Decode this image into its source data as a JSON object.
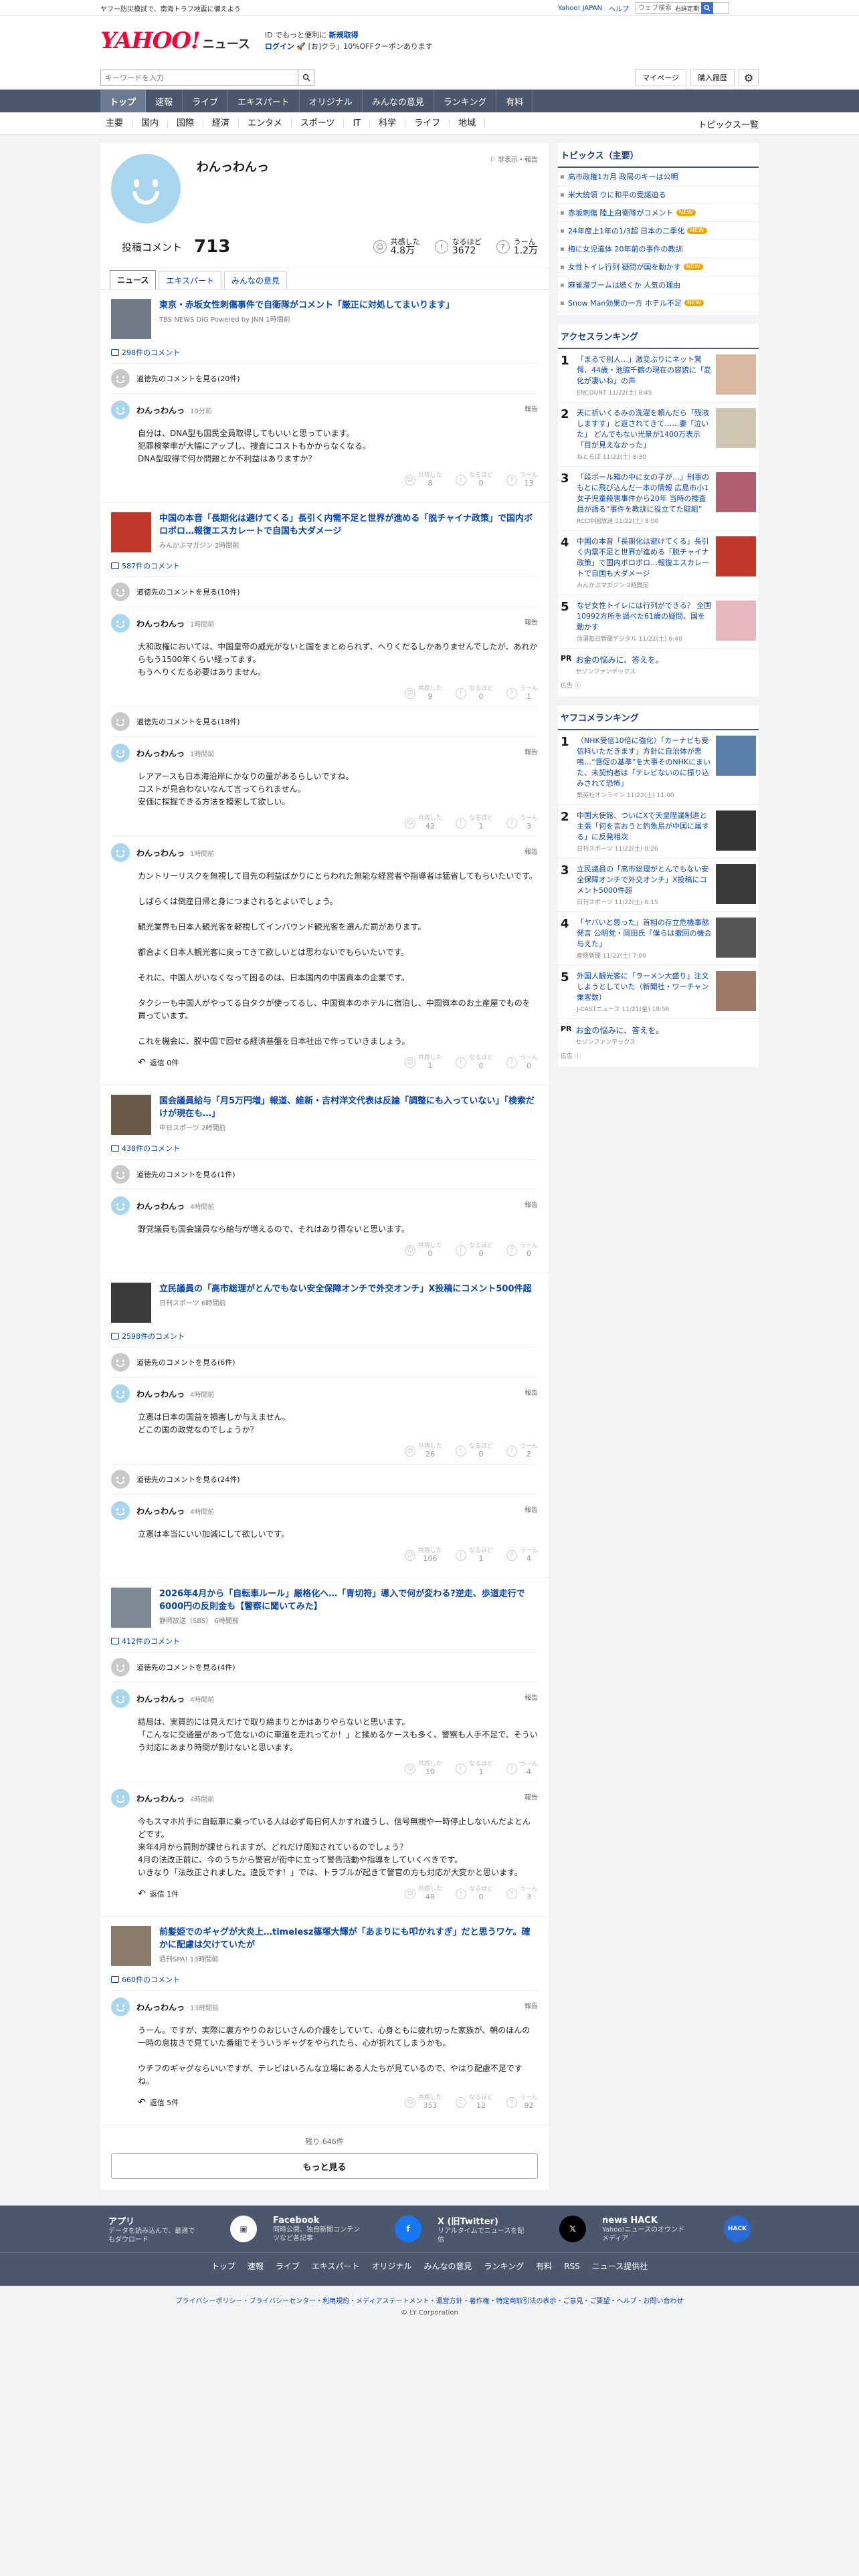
{
  "topstrip": {
    "promo": "ヤフー防災模試で、南海トラフ地震に備えよう",
    "yahoo_japan": "Yahoo! JAPAN",
    "help": "ヘルプ",
    "search_placeholder": "ウェブ検索",
    "check_label": "右詳定期"
  },
  "header": {
    "logo_text": "YAHOO!",
    "logo_sub": "ニュース",
    "promo_line1a": "ID でもっと便利に ",
    "promo_line1b": "新規取得",
    "login": "ログイン",
    "promo_line2": "[お]クラ」10%OFFクーポンあります"
  },
  "subhead": {
    "keyword_placeholder": "キーワードを入力",
    "mypage": "マイページ",
    "purchase": "購入履歴"
  },
  "gnav": [
    "トップ",
    "速報",
    "ライブ",
    "エキスパート",
    "オリジナル",
    "みんなの意見",
    "ランキング",
    "有料"
  ],
  "catnav": [
    "主要",
    "国内",
    "国際",
    "経済",
    "エンタメ",
    "スポーツ",
    "IT",
    "科学",
    "ライフ",
    "地域"
  ],
  "catnav_last": "トピックス一覧",
  "profile": {
    "name": "わんっわんっ",
    "report": "非表示・報告",
    "comments_label": "投稿コメント",
    "comments_count": "713",
    "stats": [
      {
        "icon": "☺",
        "label": "共感した",
        "value": "4.8万"
      },
      {
        "icon": "!",
        "label": "なるほど",
        "value": "3672"
      },
      {
        "icon": "?",
        "label": "うーん",
        "value": "1.2万"
      }
    ]
  },
  "tabs": [
    "ニュース",
    "エキスパート",
    "みんなの意見"
  ],
  "articles": [
    {
      "title": "東京・赤坂女性刺傷事件で自衛隊がコメント「厳正に対処してまいります」",
      "source": "TBS NEWS DIG Powered by JNN 1時間前",
      "count": "298件のコメント",
      "other": "道徳先のコメントを見る(20件)",
      "comments": [
        {
          "name": "わんっわんっ",
          "time": "10分前",
          "body": "自分は、DNA型も国民全員取得してもいいと思っています。\n犯罪検挙率が大幅にアップし、捜査にコストもかからなくなる。\nDNA型取得で何か問題とか不利益はありますか？",
          "r": [
            "8",
            "0",
            "13"
          ],
          "reply": ""
        }
      ]
    },
    {
      "title": "中国の本音「長期化は避けてくる」長引く内需不足と世界が進める「脱チャイナ政策」で国内ボロボロ…報復エスカレートで自国も大ダメージ",
      "source": "みんかぶマガジン 2時間前",
      "count": "587件のコメント",
      "other": "道徳先のコメントを見る(10件)",
      "comments": [
        {
          "name": "わんっわんっ",
          "time": "1時間前",
          "body": "大和政権においては、中国皇帝の威光がないと国をまとめられず、へりくだるしかありませんでしたが、あれからもう1500年くらい経ってます。\nもうへりくだる必要はありません。",
          "r": [
            "9",
            "0",
            "1"
          ],
          "reply": ""
        }
      ],
      "other2": "道徳先のコメントを見る(18件)",
      "comments2": [
        {
          "name": "わんっわんっ",
          "time": "1時間前",
          "body": "レアアースも日本海沿岸にかなりの量があるらしいですね。\nコストが見合わないなんて言ってられません。\n安価に採掘できる方法を模索して欲しい。",
          "r": [
            "42",
            "1",
            "3"
          ],
          "reply": ""
        },
        {
          "name": "わんっわんっ",
          "time": "1時間前",
          "body": "カントリーリスクを無視して目先の利益ばかりにとらわれた無能な経営者や指導者は猛省してもらいたいです。\n\nしばらくは倒産日帰と身につまされるとよいでしょう。\n\n観光業界も日本人観光客を軽視してインバウンド観光客を選んだ罰があります。\n\n都合よく日本人観光客に戻ってきて欲しいとは思わないでもらいたいです。\n\nそれに、中国人がいなくなって困るのは、日本国内の中国資本の企業です。\n\nタクシーも中国人がやってる白タクが使ってるし、中国資本のホテルに宿泊し、中国資本のお土産屋でものを買っています。\n\nこれを機会に、脱中国で回せる経済基盤を日本社出で作っていきましょう。",
          "r": [
            "1",
            "0",
            "0"
          ],
          "reply": "返信 0件"
        }
      ]
    },
    {
      "title": "国会議員給与「月5万円増」報道、維新・吉村洋文代表は反論「調整にも入っていない」「検索だけが現在も…」",
      "source": "中日スポーツ 2時間前",
      "count": "438件のコメント",
      "other": "道徳先のコメントを見る(1件)",
      "comments": [
        {
          "name": "わんっわんっ",
          "time": "4時間前",
          "body": "野党議員も国会議員なら給与が増えるので、それはあり得ないと思います。",
          "r": [
            "0",
            "0",
            "0"
          ],
          "reply": ""
        }
      ]
    },
    {
      "title": "立民議員の「高市総理がとんでもない安全保障オンチで外交オンチ」X投稿にコメント500件超",
      "source": "日刊スポーツ 6時間前",
      "count": "2598件のコメント",
      "other": "道徳先のコメントを見る(6件)",
      "comments": [
        {
          "name": "わんっわんっ",
          "time": "4時間前",
          "body": "立憲は日本の国益を損害しか与えません。\nどこの国の政党なのでしょうか？",
          "r": [
            "26",
            "0",
            "2"
          ],
          "reply": ""
        }
      ],
      "other2": "道徳先のコメントを見る(24件)",
      "comments2": [
        {
          "name": "わんっわんっ",
          "time": "4時間前",
          "body": "立憲は本当にいい加減にして欲しいです。",
          "r": [
            "106",
            "1",
            "4"
          ],
          "reply": ""
        }
      ]
    },
    {
      "title": "2026年4月から「自転車ルール」厳格化へ…「青切符」導入で何が変わる?逆走、歩道走行で6000円の反則金も【警察に聞いてみた】",
      "source": "静岡放送（SBS） 6時間前",
      "count": "412件のコメント",
      "other": "道徳先のコメントを見る(4件)",
      "comments": [
        {
          "name": "わんっわんっ",
          "time": "4時間前",
          "body": "結局は、実質的には見えだけで取り締まりとかはありやらないと思います。\n「こんなに交通量があって危ないのに車道を走れってか！」と揉めるケースも多く、警察も人手不足で、そういう対応にあまり時間が割けないと思います。",
          "r": [
            "10",
            "1",
            "4"
          ],
          "reply": ""
        },
        {
          "name": "わんっわんっ",
          "time": "4時間前",
          "body": "今もスマホ片手に自転車に乗っている人は必ず毎日何人かすれ違うし、信号無視や一時停止しないんだよとんどです。\n来年4月から罰則が課せられますが、どれだけ周知されているのでしょう？\n4月の法改正前に、今のうちから警官が街中に立って警告活動や指導をしていくべきです。\nいきなり「法改正されました。違反です！」では、トラブルが起きて警官の方も対応が大変かと思います。",
          "r": [
            "48",
            "0",
            "3"
          ],
          "reply": "返信 1件"
        }
      ]
    },
    {
      "title": "前髪姫でのギャグが大炎上…timelesz篠塚大輝が「あまりにも叩かれすぎ」だと思うワケ。確かに配慮は欠けていたが",
      "source": "週刊SPA! 13時間前",
      "count": "660件のコメント",
      "other": "",
      "comments": [
        {
          "name": "わんっわんっ",
          "time": "13時間前",
          "body": "うーん。ですが、実際に裏方やりのおじいさんの介護をしていて、心身ともに疲れ切った家族が、朝のほんの一時の息抜きで見ていた番組でそういうギャグをやられたら、心が折れてしまうかも。\n\nウチフのギャグならいいですが、テレビはいろんな立場にある人たちが見ているので、やはり配慮不足ですね。",
          "r": [
            "353",
            "12",
            "92"
          ],
          "reply": "返信 5件"
        }
      ]
    }
  ],
  "react_labels": [
    "共感した",
    "なるほど",
    "うーん"
  ],
  "more": {
    "remaining": "残り 646件",
    "button": "もっと見る"
  },
  "report_label": "報告",
  "right": {
    "topics_title": "トピックス（主要）",
    "topics": [
      {
        "t": "高市政権1カ月 政局のキーは公明",
        "new": false
      },
      {
        "t": "米大統領 ウに和平の受諾迫る",
        "new": false
      },
      {
        "t": "赤坂刺傷 陸上自衛隊がコメント",
        "new": true
      },
      {
        "t": "24年度上1年の1/3超 日本の二季化",
        "new": true
      },
      {
        "t": "梅に女児遺体 20年前の事件の教訓",
        "new": false
      },
      {
        "t": "女性トイレ行列 疑問が国を動かす",
        "new": true
      },
      {
        "t": "麻雀漫ブームは続くか 人気の理由",
        "new": false
      },
      {
        "t": "Snow Man効果の一方 ホテル不足",
        "new": true
      }
    ],
    "new_label": "NEW",
    "access_title": "アクセスランキング",
    "access": [
      {
        "t": "「まるで別人…」激変ぶりにネット驚愕、44歳・池脇千鶴の現在の容貌に「変化が凄いね」の声",
        "s": "ENCOUNT 11/22(土) 8:45",
        "c": "#d9b8a0"
      },
      {
        "t": "天に祈いくるみの洗濯を頼んだら「残液しますす」と返されてきて……妻「泣いた」 どんでもない光景が1400万表示「目が見えなかった」",
        "s": "ねとらぼ 11/22(土) 8:30",
        "c": "#cfc6b2"
      },
      {
        "t": "「段ボール箱の中に女の子が…」刑事のもとに飛び込んだ一本の情報 広島市小1女子児童殺害事件から20年 当時の捜査員が語る“事件を教訓に役立てた取組”",
        "s": "RCC中国放送 11/22(土) 8:00",
        "c": "#b06070"
      },
      {
        "t": "中国の本音「長期化は避けてくる」長引く内需不足と世界が進める「脱チャイナ政策」で国内ボロボロ…報復エスカレートで自国も大ダメージ",
        "s": "みんかぶマガジン 2時間前",
        "c": "#c0392b"
      },
      {
        "t": "なぜ女性トイレには行列ができる？ 全国10992方所を調べた61歳の疑問、国を動かす",
        "s": "信濃毎日新聞デジタル 11/22(土) 6:40",
        "c": "#e8b8c0"
      }
    ],
    "pr1": {
      "label": "PR",
      "title": "お金の悩みに、答えを。",
      "sponsor": "セゾンファンデックス"
    },
    "ad_label": "広告",
    "yafoo_title": "ヤフコメランキング",
    "yafoo": [
      {
        "t": "〈NHK受信10倍に強化〉「カーナビも受信料いただきます」方針に自治体が悲鳴…“督促の基準”を大事そのNHKにまいた、未契約者は「テレビないのに振り込みされて恐怖」",
        "s": "集英社オンライン 11/22(土) 11:00",
        "c": "#5a7fa8"
      },
      {
        "t": "中国大使館、ついにXで天皇陛議制退と主張「何を言おうと釣魚島が中国に属する」に反発相次",
        "s": "日刊スポーツ 11/22(土) 8:26",
        "c": "#333"
      },
      {
        "t": "立民議員の「高市総理がとんでもない安全保障オンチで外交オンチ」X投稿にコメント5000件超",
        "s": "日刊スポーツ 11/22(土) 6:15",
        "c": "#3a3a3a"
      },
      {
        "t": "「ヤバいと思った」首相の存立危機事態発言 公明党・岡田氏「僕らは撤回の機会与えた」",
        "s": "産経新聞 11/22(土) 7:00",
        "c": "#555"
      },
      {
        "t": "外国人観光客に「ラーメン大盛り」注文しようとしていた（新聞社・ワーチャン乗客数）",
        "s": "J-CASTニュース 11/21(金) 19:56",
        "c": "#a0786a"
      }
    ],
    "pr2": {
      "label": "PR",
      "title": "お金の悩みに、答えを。",
      "sponsor": "セゾンファンデックス"
    }
  },
  "footer": {
    "items": [
      {
        "t": "アプリ",
        "d": "データを読み込んで、最適でもダウロード"
      },
      {
        "t": "Facebook",
        "d": "同時公開、独自新聞コンテンツなど各記事"
      },
      {
        "t": "X (旧Twitter)",
        "d": "リアルタイムでニュースを配信"
      },
      {
        "t": "news HACK",
        "d": "Yahoo!ニュースのオウンドメディア"
      }
    ],
    "links": [
      "トップ",
      "速報",
      "ライブ",
      "エキスパート",
      "オリジナル",
      "みんなの意見",
      "ランキング",
      "有料",
      "RSS",
      "ニュース提供社"
    ],
    "legal": "プライバシーポリシー・プライバシーセンター・利用規約・メディアステートメント・運営方針・著作権・特定商取引法の表示・ご意見・ご要望・ヘルプ・お問い合わせ",
    "copyright": "© LY Corporation"
  }
}
